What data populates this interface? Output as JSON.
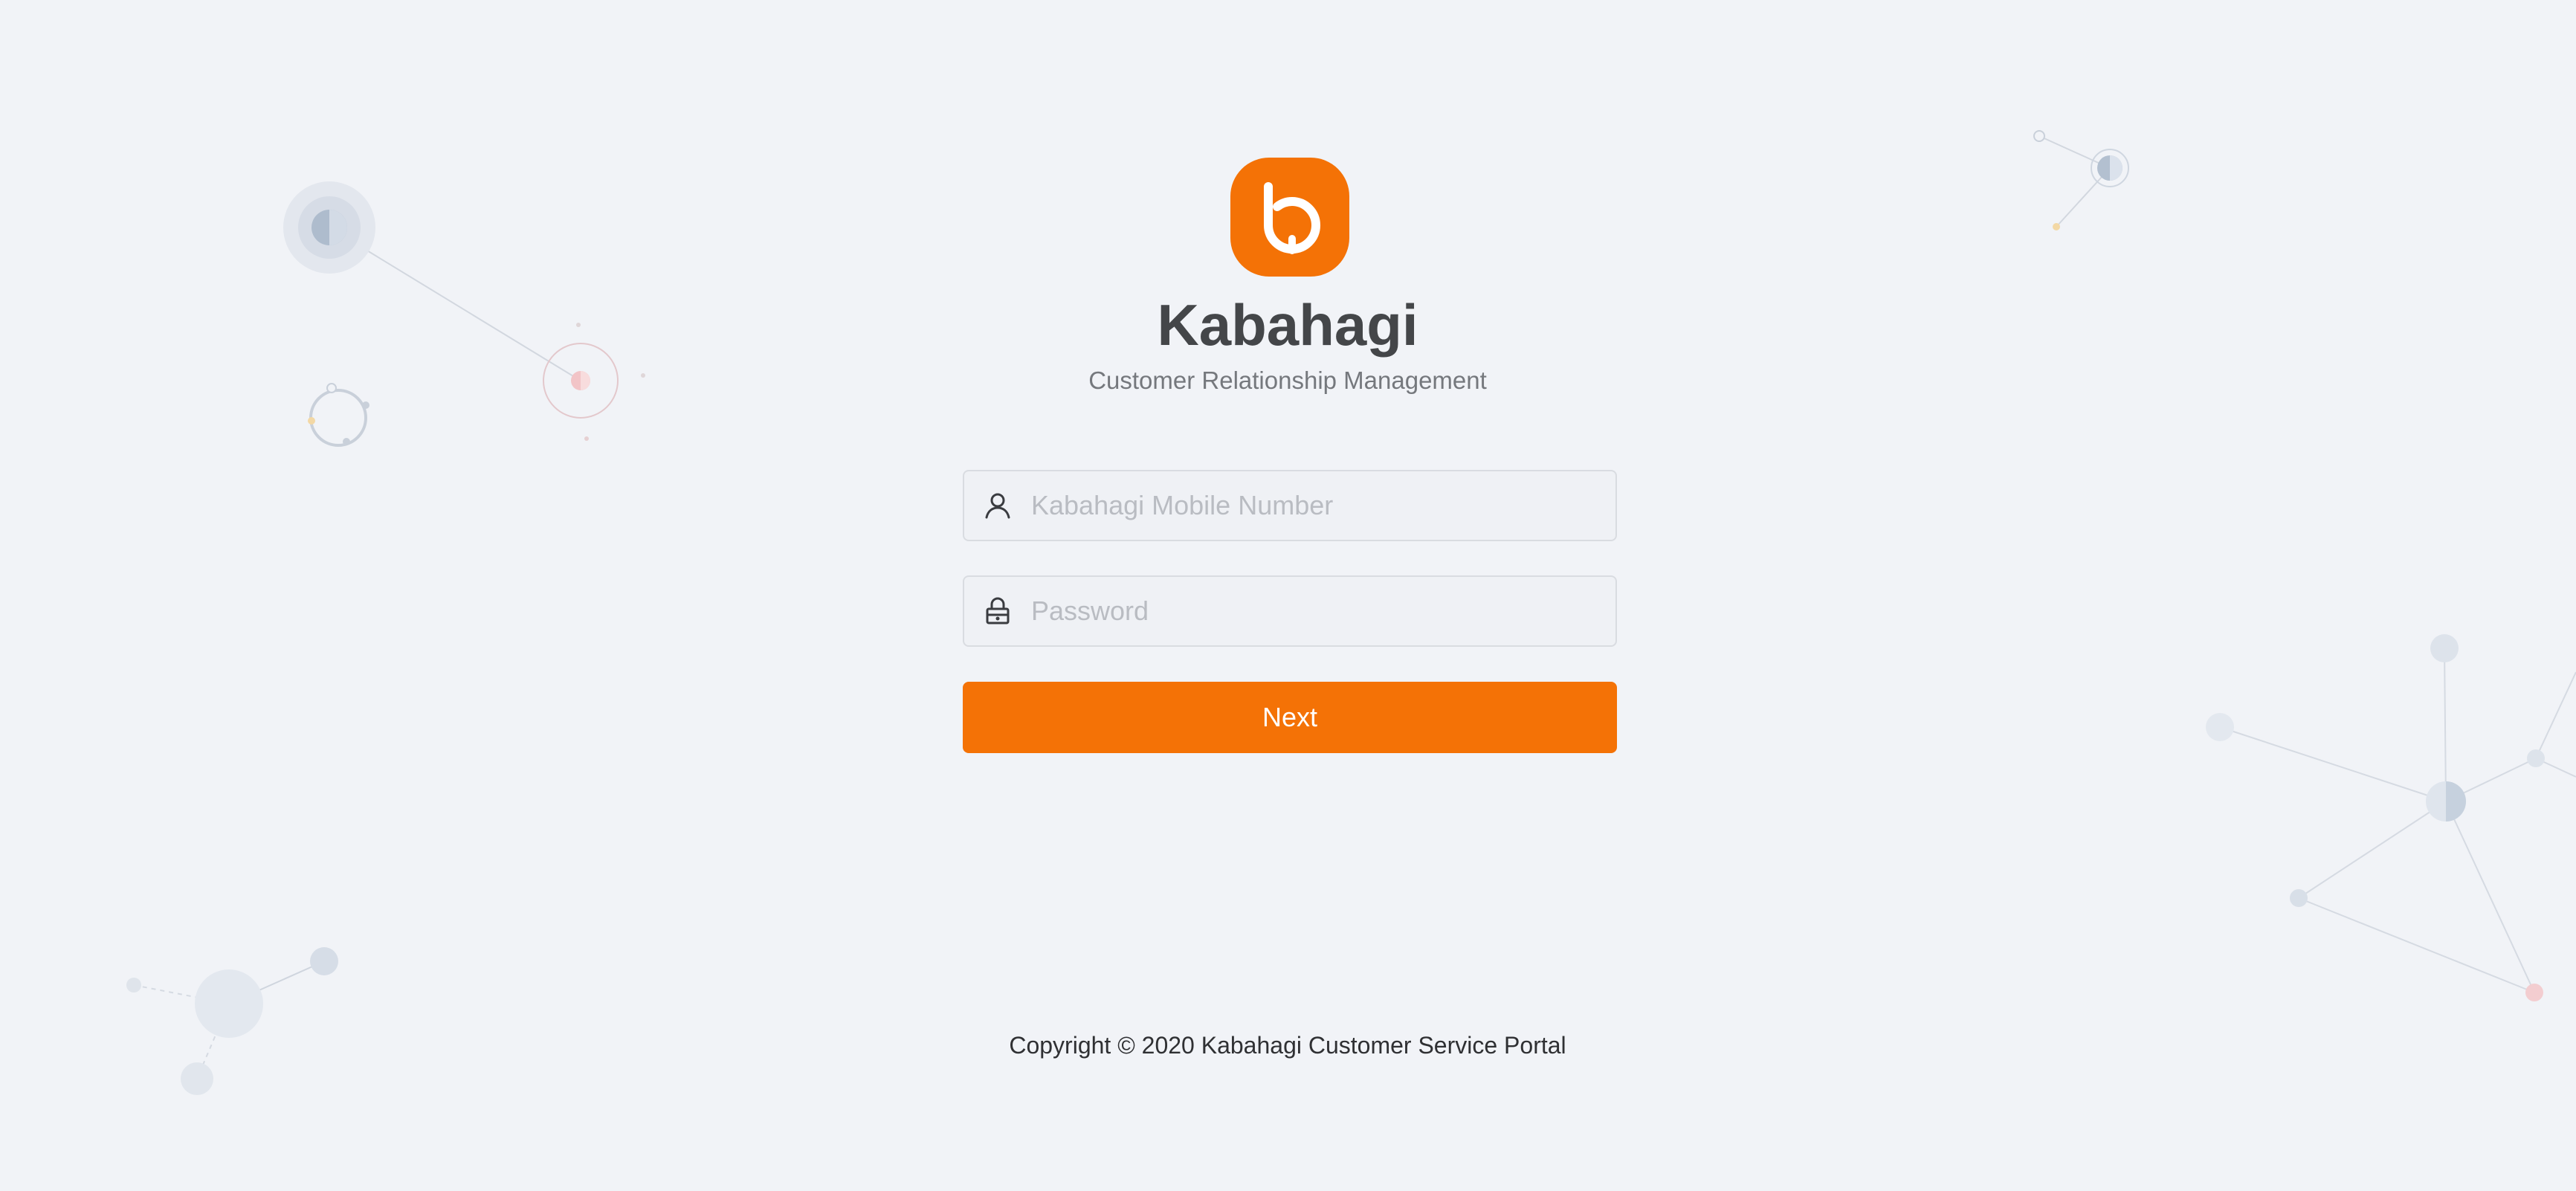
{
  "brand": {
    "logo_icon": "kabahagi-b-logo-icon",
    "accent_color": "#f47206",
    "title": "Kabahagi",
    "subtitle": "Customer Relationship Management"
  },
  "login_form": {
    "mobile_field": {
      "icon": "user-icon",
      "placeholder": "Kabahagi Mobile Number",
      "value": ""
    },
    "password_field": {
      "icon": "lock-icon",
      "placeholder": "Password",
      "value": ""
    },
    "next_label": "Next"
  },
  "footer": {
    "copyright": "Copyright © 2020 Kabahagi Customer Service Portal"
  }
}
